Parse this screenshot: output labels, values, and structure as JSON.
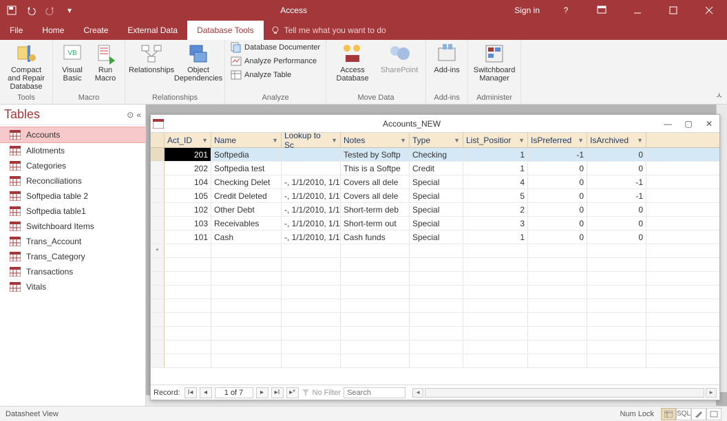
{
  "app_title": "Access",
  "signin": "Sign in",
  "tabs": [
    "File",
    "Home",
    "Create",
    "External Data",
    "Database Tools"
  ],
  "active_tab": "Database Tools",
  "tellme": "Tell me what you want to do",
  "ribbon_groups": {
    "tools": {
      "label": "Tools",
      "btn": "Compact and Repair Database"
    },
    "macro": {
      "label": "Macro",
      "b1": "Visual Basic",
      "b2": "Run Macro"
    },
    "relationships": {
      "label": "Relationships",
      "b1": "Relationships",
      "b2": "Object Dependencies"
    },
    "analyze": {
      "label": "Analyze",
      "s1": "Database Documenter",
      "s2": "Analyze Performance",
      "s3": "Analyze Table"
    },
    "movedata": {
      "label": "Move Data",
      "b1": "Access Database",
      "b2": "SharePoint"
    },
    "addins": {
      "label": "Add-ins",
      "b1": "Add-ins"
    },
    "administer": {
      "label": "Administer",
      "b1": "Switchboard Manager"
    }
  },
  "nav": {
    "title": "Tables",
    "items": [
      "Accounts",
      "Allotments",
      "Categories",
      "Reconciliations",
      "Softpedia table 2",
      "Softpedia table1",
      "Switchboard Items",
      "Trans_Account",
      "Trans_Category",
      "Transactions",
      "Vitals"
    ],
    "selected": "Accounts"
  },
  "doc": {
    "title": "Accounts_NEW",
    "columns": [
      "Act_ID",
      "Name",
      "Lookup to Sc",
      "Notes",
      "Type",
      "List_Positior",
      "IsPreferred",
      "IsArchived"
    ],
    "rows": [
      {
        "id": "201",
        "name": "Softpedia",
        "look": "",
        "notes": "Tested by Softp",
        "type": "Checking",
        "list": "1",
        "pref": "-1",
        "arch": "0",
        "sel": true,
        "edit": true
      },
      {
        "id": "202",
        "name": "Softpedia test",
        "look": "",
        "notes": "This is a Softpe",
        "type": "Credit",
        "list": "1",
        "pref": "0",
        "arch": "0"
      },
      {
        "id": "104",
        "name": "Checking Delet",
        "look": "-, 1/1/2010, 1/1",
        "notes": "Covers all dele",
        "type": "Special",
        "list": "4",
        "pref": "0",
        "arch": "-1"
      },
      {
        "id": "105",
        "name": "Credit Deleted",
        "look": "-, 1/1/2010, 1/1",
        "notes": "Covers all dele",
        "type": "Special",
        "list": "5",
        "pref": "0",
        "arch": "-1"
      },
      {
        "id": "102",
        "name": "Other Debt",
        "look": "-, 1/1/2010, 1/1",
        "notes": "Short-term deb",
        "type": "Special",
        "list": "2",
        "pref": "0",
        "arch": "0"
      },
      {
        "id": "103",
        "name": "Receivables",
        "look": "-, 1/1/2010, 1/1",
        "notes": "Short-term out",
        "type": "Special",
        "list": "3",
        "pref": "0",
        "arch": "0"
      },
      {
        "id": "101",
        "name": "Cash",
        "look": "-, 1/1/2010, 1/1",
        "notes": "Cash funds",
        "type": "Special",
        "list": "1",
        "pref": "0",
        "arch": "0"
      }
    ],
    "recnav": {
      "label": "Record:",
      "pos": "1 of 7",
      "nofilter": "No Filter",
      "search_placeholder": "Search"
    }
  },
  "status": {
    "left": "Datasheet View",
    "numlock": "Num Lock",
    "sql": "SQL"
  }
}
